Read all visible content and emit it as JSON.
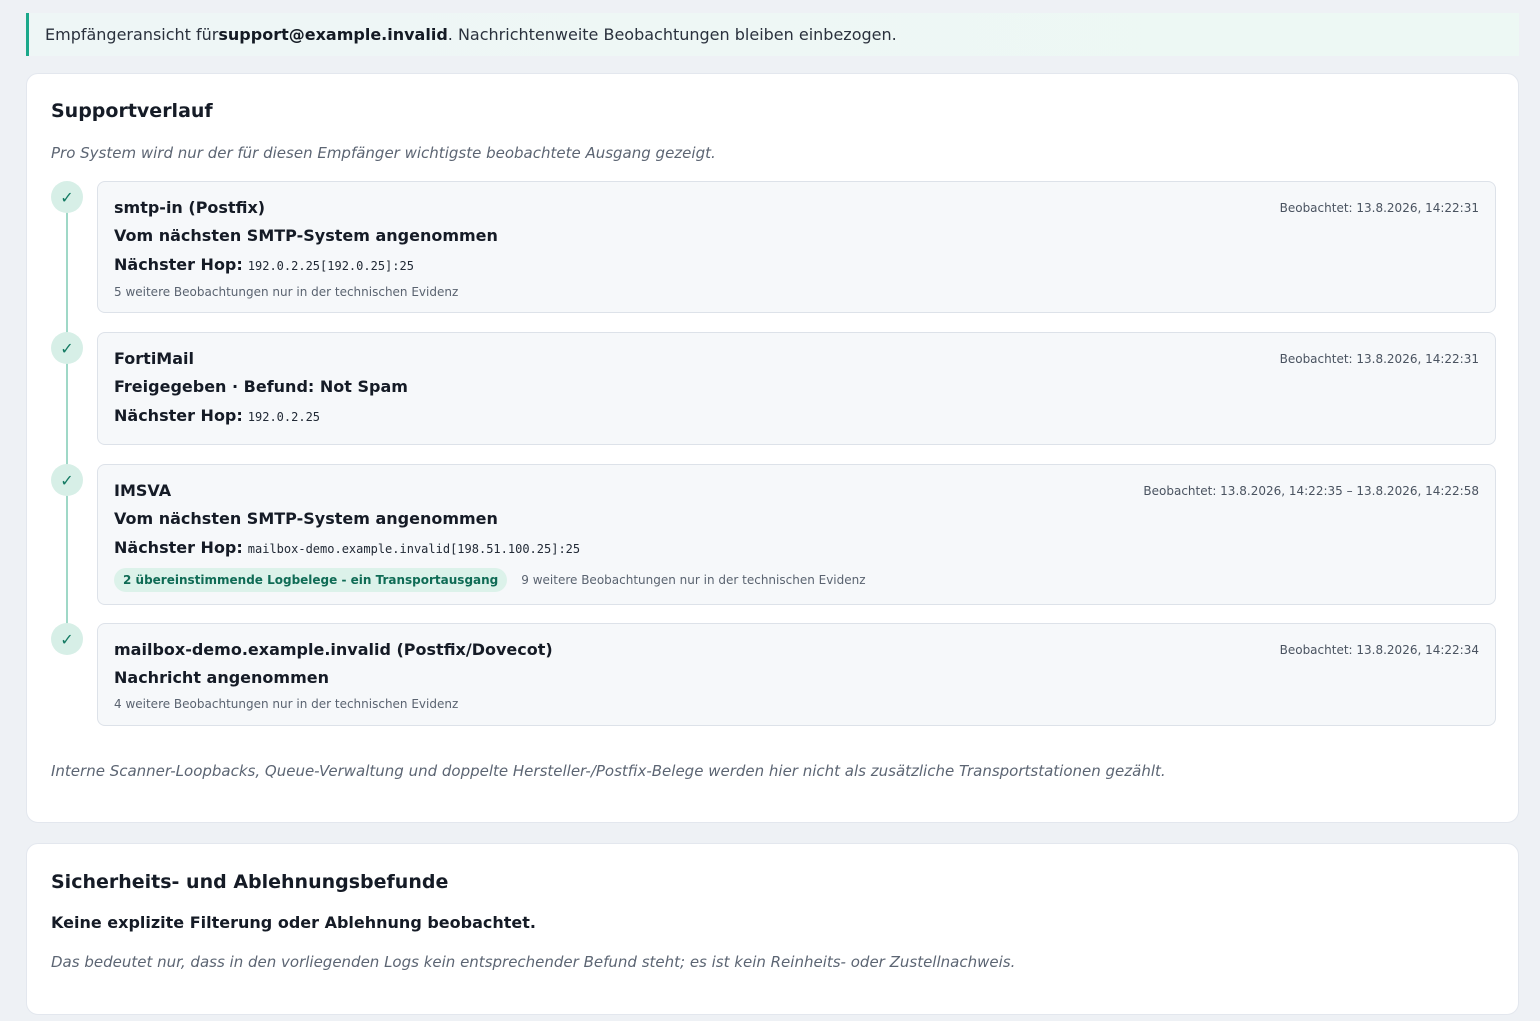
{
  "banner": {
    "prefix": "Empfängeransicht für ",
    "recipient": "support@example.invalid",
    "suffix": ". Nachrichtenweite Beobachtungen bleiben einbezogen."
  },
  "support": {
    "title": "Supportverlauf",
    "intro": "Pro System wird nur der für diesen Empfänger wichtigste beobachtete Ausgang gezeigt.",
    "hop_label": "Nächster Hop:",
    "check_glyph": "✓",
    "steps": [
      {
        "system": "smtp-in (Postfix)",
        "observed": "Beobachtet: 13.8.2026, 14:22:31",
        "status": "Vom nächsten SMTP-System angenommen",
        "next_hop": "192.0.2.25[192.0.25]:25",
        "more": "5 weitere Beobachtungen nur in der technischen Evidenz"
      },
      {
        "system": "FortiMail",
        "observed": "Beobachtet: 13.8.2026, 14:22:31",
        "status": "Freigegeben · Befund: Not Spam",
        "next_hop": "192.0.2.25"
      },
      {
        "system": "IMSVA",
        "observed": "Beobachtet: 13.8.2026, 14:22:35 – 13.8.2026, 14:22:58",
        "status": "Vom nächsten SMTP-System angenommen",
        "next_hop": "mailbox-demo.example.invalid[198.51.100.25]:25",
        "badge": "2 übereinstimmende Logbelege - ein Transportausgang",
        "more": "9 weitere Beobachtungen nur in der technischen Evidenz"
      },
      {
        "system": "mailbox-demo.example.invalid (Postfix/Dovecot)",
        "observed": "Beobachtet: 13.8.2026, 14:22:34",
        "status": "Nachricht angenommen",
        "more": "4 weitere Beobachtungen nur in der technischen Evidenz"
      }
    ],
    "footnote": "Interne Scanner-Loopbacks, Queue-Verwaltung und doppelte Hersteller-/Postfix-Belege werden hier nicht als zusätzliche Transportstationen gezählt."
  },
  "security": {
    "title": "Sicherheits- und Ablehnungsbefunde",
    "subtitle": "Keine explizite Filterung oder Ablehnung beobachtet.",
    "note": "Das bedeutet nur, dass in den vorliegenden Logs kein entsprechender Befund steht; es ist kein Reinheits- oder Zustellnachweis."
  },
  "colors": {
    "accent": "#1aa88a",
    "badge_bg": "#dcf2ea",
    "badge_text": "#0f6b55",
    "timeline": "#9fd8c7"
  }
}
